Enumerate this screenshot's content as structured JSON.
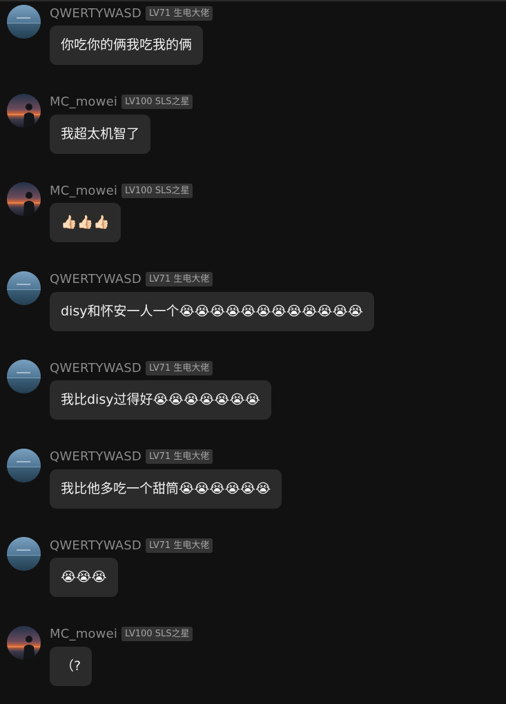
{
  "messages": [
    {
      "avatar": "sea-avatar",
      "username": "QWERTYWASD",
      "badge": "LV71 生电大佬",
      "text": "你吃你的俩我吃我的俩"
    },
    {
      "avatar": "sunset-avatar",
      "username": "MC_mowei",
      "badge": "LV100 SLS之星",
      "text": "我超太机智了"
    },
    {
      "avatar": "sunset-avatar",
      "username": "MC_mowei",
      "badge": "LV100 SLS之星",
      "text": "👍🏻👍🏻👍🏻"
    },
    {
      "avatar": "sea-avatar",
      "username": "QWERTYWASD",
      "badge": "LV71 生电大佬",
      "text": "disy和怀安一人一个😭😭😭😭😭😭😭😭😭😭😭😭"
    },
    {
      "avatar": "sea-avatar",
      "username": "QWERTYWASD",
      "badge": "LV71 生电大佬",
      "text": "我比disy过得好😭😭😭😭😭😭😭"
    },
    {
      "avatar": "sea-avatar",
      "username": "QWERTYWASD",
      "badge": "LV71 生电大佬",
      "text": "我比他多吃一个甜筒😭😭😭😭😭😭"
    },
    {
      "avatar": "sea-avatar",
      "username": "QWERTYWASD",
      "badge": "LV71 生电大佬",
      "text": "😭😭😭"
    },
    {
      "avatar": "sunset-avatar",
      "username": "MC_mowei",
      "badge": "LV100 SLS之星",
      "text": "（?"
    }
  ]
}
